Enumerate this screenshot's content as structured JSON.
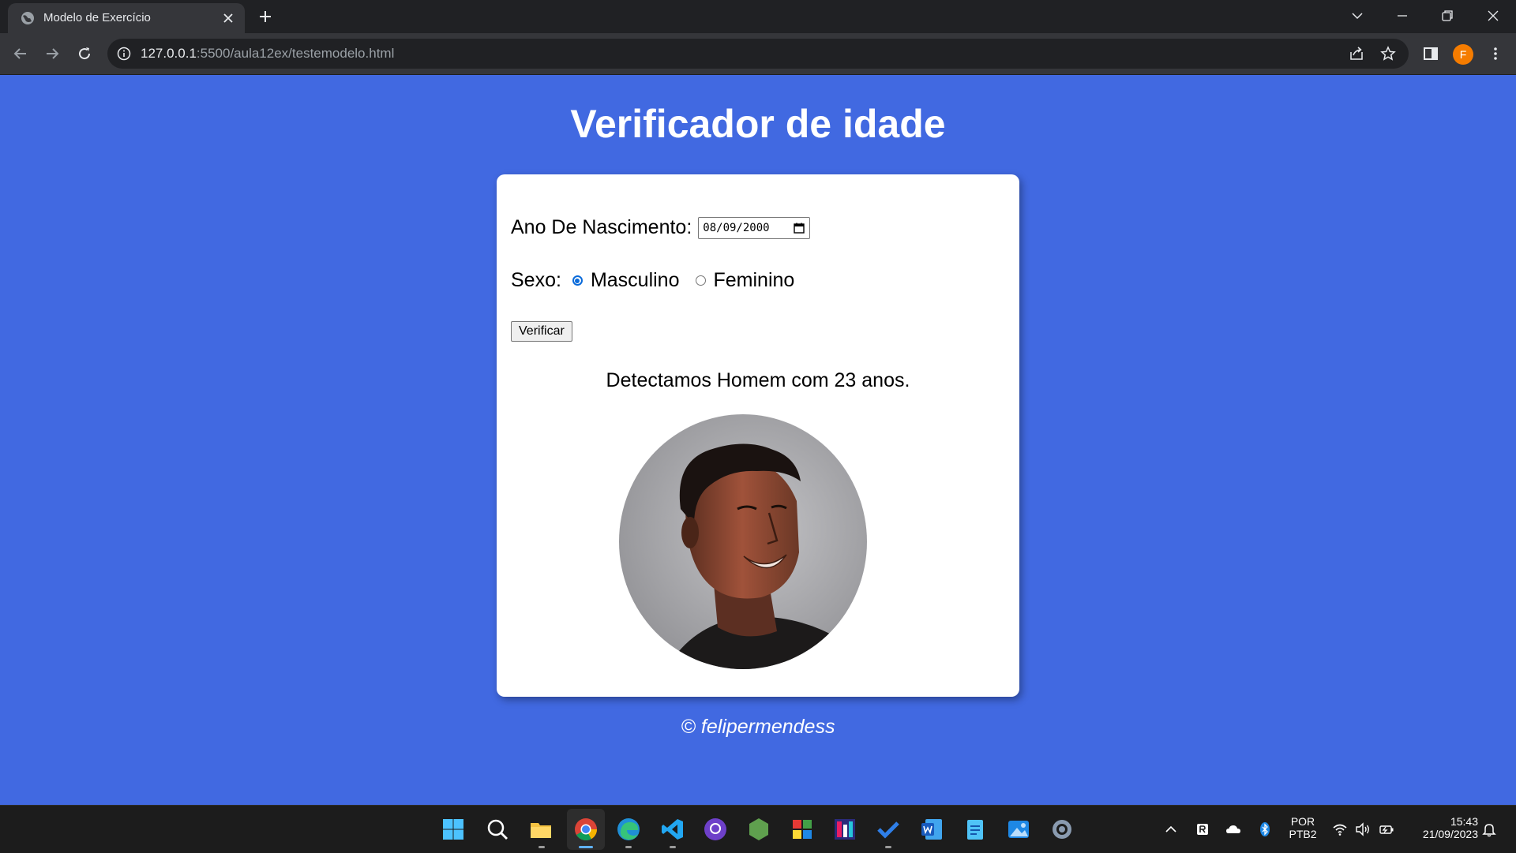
{
  "browser": {
    "tab_title": "Modelo de Exercício",
    "url_host": "127.0.0.1",
    "url_rest": ":5500/aula12ex/testemodelo.html",
    "profile_initial": "F",
    "accent_color": "#f57c00"
  },
  "page": {
    "title": "Verificador de idade",
    "background_color": "#4169e1",
    "form": {
      "birth_label": "Ano De Nascimento:",
      "birth_value": "08/09/2000",
      "sex_label": "Sexo:",
      "options": [
        {
          "label": "Masculino",
          "checked": true
        },
        {
          "label": "Feminino",
          "checked": false
        }
      ],
      "button_label": "Verificar"
    },
    "result": "Detectamos Homem com 23 anos.",
    "photo": "young man smiling, circular portrait",
    "footer": "© felipermendess"
  },
  "taskbar": {
    "apps": [
      "windows-start-icon",
      "search-icon",
      "file-explorer-icon",
      "chrome-icon",
      "edge-icon",
      "vscode-icon",
      "github-desktop-icon",
      "nodejs-icon",
      "color-app-icon",
      "jetbrains-icon",
      "todo-icon",
      "word-icon",
      "notepad-icon",
      "photos-icon",
      "settings-icon"
    ],
    "lang_top": "POR",
    "lang_bottom": "PTB2",
    "time": "15:43",
    "date": "21/09/2023"
  }
}
